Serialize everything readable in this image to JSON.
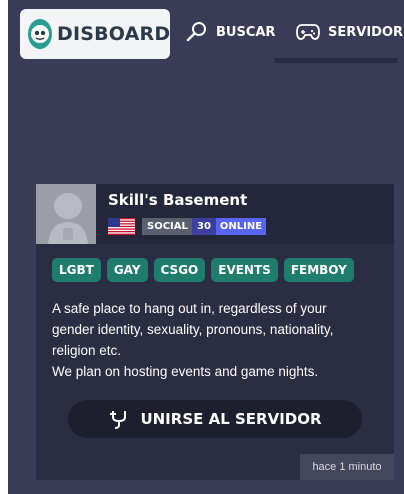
{
  "logo": {
    "text": "DISBOARD"
  },
  "nav": {
    "search_label": "BUSCAR",
    "servers_label": "SERVIDORE"
  },
  "server": {
    "name": "Skill's Basement",
    "category": "SOCIAL",
    "online_count": "30",
    "online_label": "ONLINE",
    "tags": [
      "LGBT",
      "GAY",
      "CSGO",
      "EVENTS",
      "FEMBOY"
    ],
    "description_lines": [
      "A safe place to hang out in, regardless of your",
      "gender identity, sexuality, pronouns, nationality,",
      "religion etc.",
      "We plan on hosting events and game nights."
    ],
    "join_label": "UNIRSE AL SERVIDOR",
    "timestamp": "hace 1 minuto"
  },
  "colors": {
    "background": "#393b57",
    "card": "#2b2d42",
    "tag": "#1f7d6e",
    "online": "#5865f2"
  }
}
